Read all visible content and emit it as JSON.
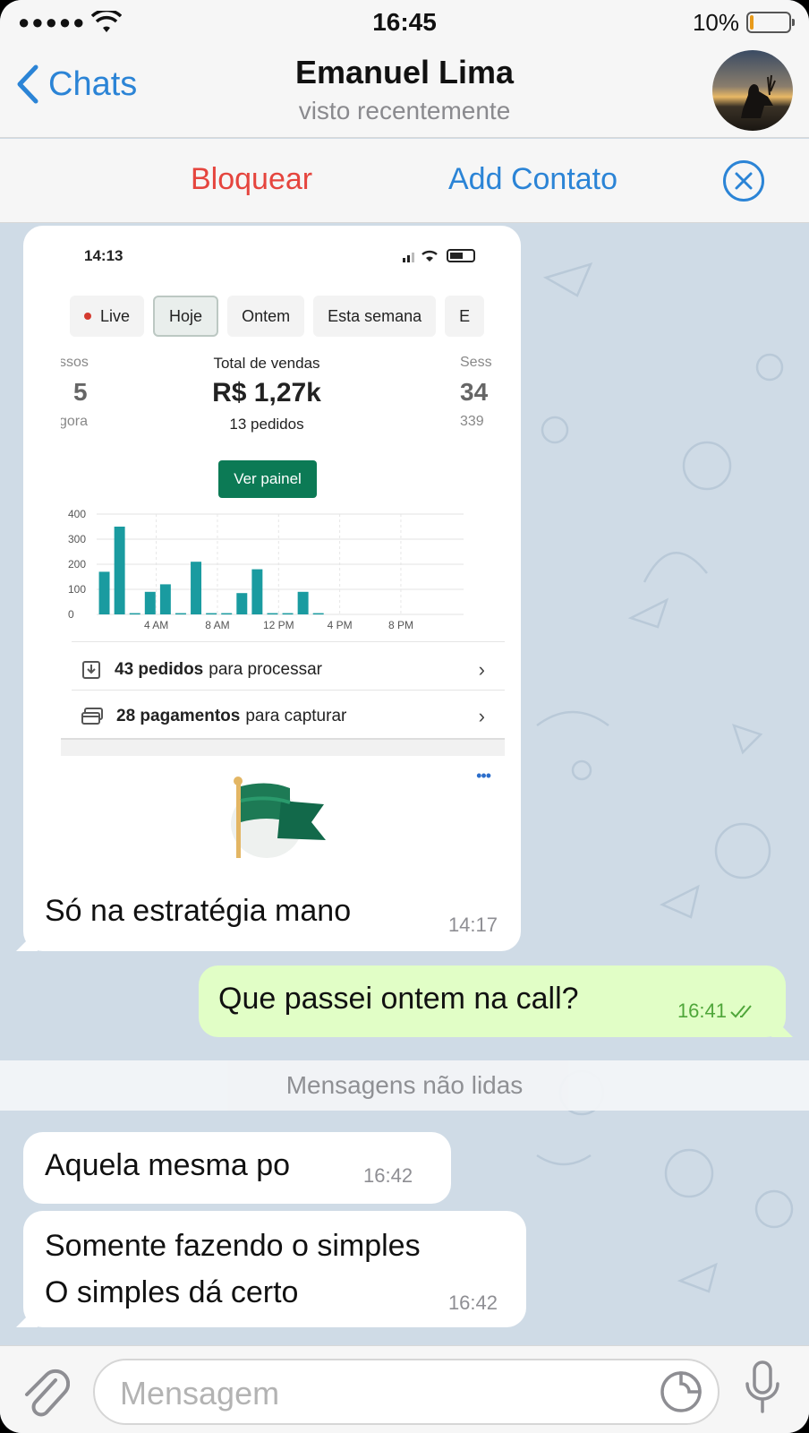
{
  "status_bar": {
    "signal": "●●●●●",
    "time": "16:45",
    "battery_percent": "10%",
    "battery_level": 0.1
  },
  "nav": {
    "back_label": "Chats",
    "title": "Emanuel Lima",
    "subtitle": "visto recentemente"
  },
  "actions": {
    "block_label": "Bloquear",
    "add_contact_label": "Add Contato"
  },
  "messages": [
    {
      "direction": "in",
      "text": "Só na estratégia mano",
      "time": "14:17",
      "has_image": true
    },
    {
      "direction": "out",
      "text": "Que passei ontem na call?",
      "time": "16:41",
      "status": "read"
    },
    {
      "direction": "in",
      "text": "Aquela mesma po",
      "time": "16:42"
    },
    {
      "direction": "in",
      "text_line1": "Somente fazendo o simples",
      "text_line2": "O simples dá certo",
      "time": "16:42"
    }
  ],
  "unread_divider": "Mensagens não lidas",
  "screenshot": {
    "time": "14:13",
    "tabs": [
      "Live",
      "Hoje",
      "Ontem",
      "Esta semana",
      "E"
    ],
    "left_metric": {
      "label": "ssos",
      "value": "5",
      "sub": "gora"
    },
    "center_metric": {
      "label": "Total de vendas",
      "value": "R$ 1,27k",
      "sub": "13 pedidos"
    },
    "right_metric": {
      "label": "Sess",
      "value": "34",
      "sub": "339"
    },
    "button": "Ver painel",
    "rows": [
      {
        "bold": "43 pedidos",
        "rest": "para processar"
      },
      {
        "bold": "28 pagamentos",
        "rest": "para capturar"
      }
    ],
    "more": "•••"
  },
  "chart_data": {
    "type": "bar",
    "series_color": "#1a9ba0",
    "ylim": [
      0,
      400
    ],
    "yticks": [
      "400",
      "300",
      "200",
      "100",
      "0"
    ],
    "xtick_labels": [
      "4 AM",
      "8 AM",
      "12 PM",
      "4 PM",
      "8 PM"
    ],
    "x": [
      0,
      1,
      2,
      3,
      4,
      5,
      6,
      7,
      8,
      9,
      10,
      11,
      12,
      13,
      14,
      15,
      16,
      17,
      18,
      19,
      20,
      21,
      22,
      23
    ],
    "values": [
      170,
      350,
      5,
      90,
      120,
      5,
      210,
      5,
      5,
      85,
      180,
      5,
      5,
      90,
      5,
      0,
      0,
      0,
      0,
      0,
      0,
      0,
      0,
      0
    ]
  },
  "input": {
    "placeholder": "Mensagem"
  }
}
